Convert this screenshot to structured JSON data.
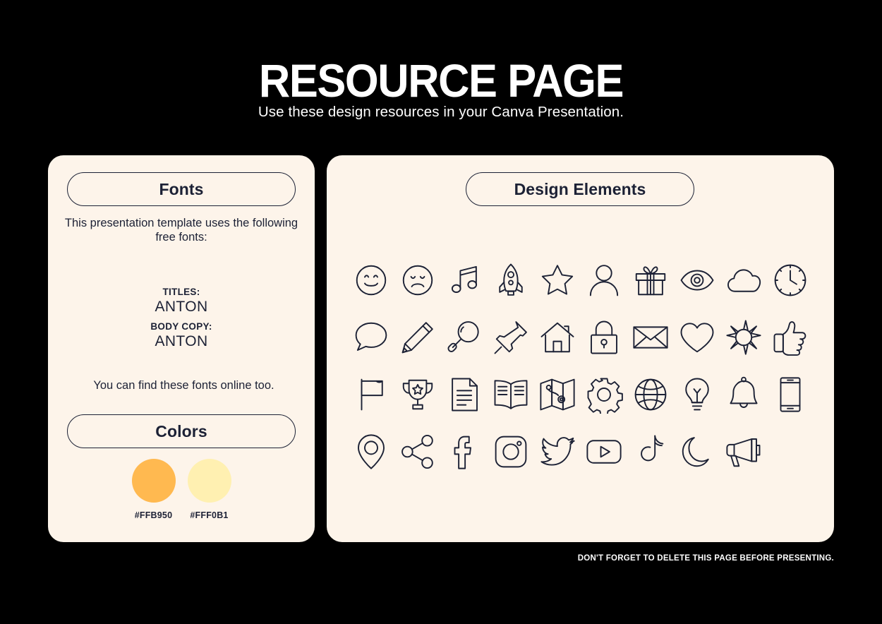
{
  "header": {
    "title": "RESOURCE PAGE",
    "subtitle": "Use these design resources in your Canva Presentation."
  },
  "fonts_card": {
    "heading": "Fonts",
    "intro": "This presentation template uses the following free fonts:",
    "titles_label": "TITLES:",
    "titles_value": "ANTON",
    "body_label": "BODY COPY:",
    "body_value": "ANTON",
    "outro": "You can find these fonts online too."
  },
  "colors_card": {
    "heading": "Colors",
    "swatches": [
      {
        "hex": "#FFB950",
        "label": "#FFB950"
      },
      {
        "hex": "#FFF0B1",
        "label": "#FFF0B1"
      }
    ]
  },
  "elements_card": {
    "heading": "Design Elements",
    "icons": [
      "smiley-face-icon",
      "sad-face-icon",
      "music-note-icon",
      "rocket-icon",
      "star-icon",
      "user-icon",
      "gift-icon",
      "eye-icon",
      "cloud-icon",
      "clock-icon",
      "speech-bubble-icon",
      "pencil-icon",
      "magnifying-glass-icon",
      "push-pin-icon",
      "house-icon",
      "lock-icon",
      "envelope-icon",
      "heart-icon",
      "sun-icon",
      "thumbs-up-icon",
      "flag-icon",
      "trophy-icon",
      "document-icon",
      "open-book-icon",
      "map-icon",
      "gear-icon",
      "globe-icon",
      "lightbulb-icon",
      "bell-icon",
      "smartphone-icon",
      "location-pin-icon",
      "share-icon",
      "facebook-icon",
      "instagram-icon",
      "twitter-icon",
      "youtube-icon",
      "tiktok-icon",
      "moon-icon",
      "megaphone-icon"
    ]
  },
  "footer": {
    "note": "DON'T FORGET TO DELETE THIS PAGE BEFORE PRESENTING."
  },
  "theme": {
    "background": "#000000",
    "card_background": "#FDF4EA",
    "ink": "#1C2135",
    "text_on_dark": "#FFFFFF"
  }
}
